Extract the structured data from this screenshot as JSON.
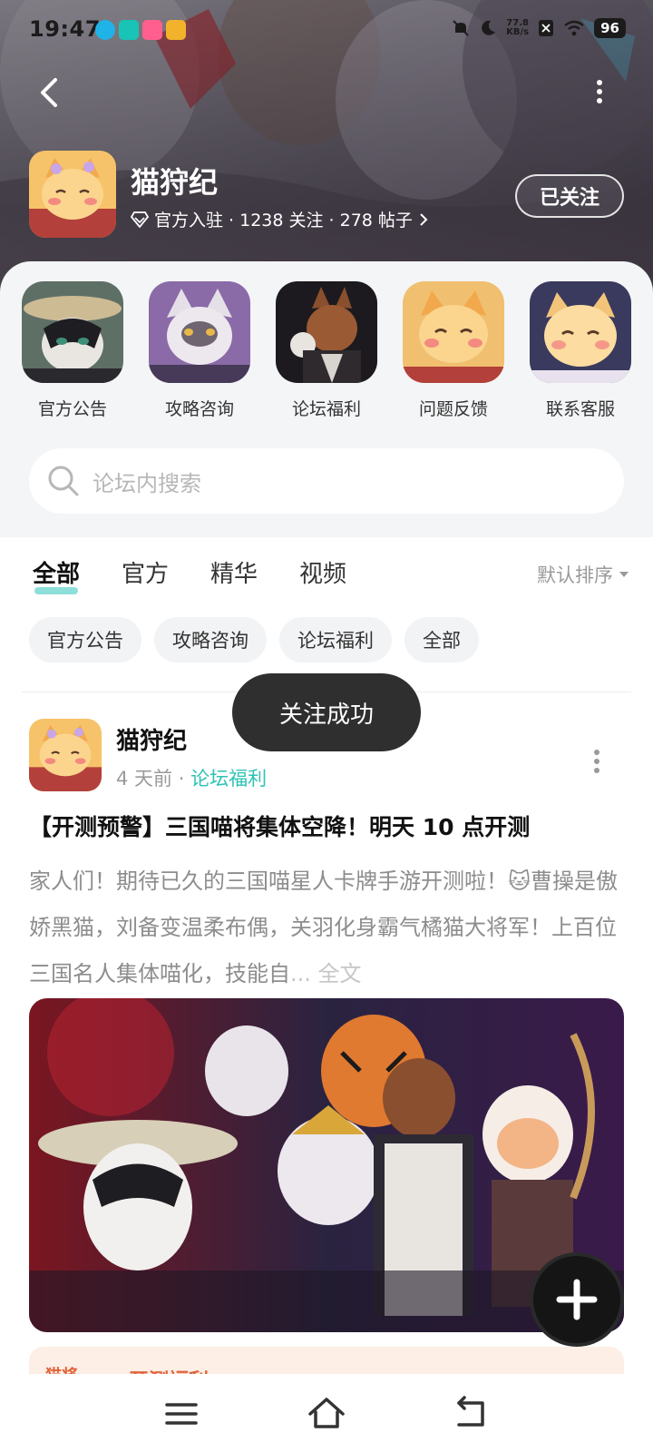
{
  "status_bar": {
    "time": "19:47",
    "net_speed_value": "77.8",
    "net_speed_unit": "KB/s",
    "battery": "96"
  },
  "forum": {
    "name": "猫狩纪",
    "meta": "官方入驻 · 1238 关注 · 278 帖子",
    "follow_label": "已关注"
  },
  "shortcuts": [
    {
      "label": "官方公告"
    },
    {
      "label": "攻略咨询"
    },
    {
      "label": "论坛福利"
    },
    {
      "label": "问题反馈"
    },
    {
      "label": "联系客服"
    }
  ],
  "search": {
    "placeholder": "论坛内搜索"
  },
  "tabs": [
    {
      "label": "全部",
      "active": true
    },
    {
      "label": "官方"
    },
    {
      "label": "精华"
    },
    {
      "label": "视频"
    }
  ],
  "sort_label": "默认排序",
  "chips": [
    "官方公告",
    "攻略咨询",
    "论坛福利",
    "全部"
  ],
  "toast": "关注成功",
  "post": {
    "author": "猫狩纪",
    "time": "4 天前",
    "category": "论坛福利",
    "title": "【开测预警】三国喵将集体空降！明天 10 点开测",
    "body": "家人们！期待已久的三国喵星人卡牌手游开测啦！🐱曹操是傲娇黑猫，刘备变温柔布偶，关羽化身霸气橘猫大将军！上百位三国名人集体喵化，技能自",
    "read_more": "... 全文"
  },
  "next_post": {
    "tag": "猫将",
    "title": "开测福利"
  },
  "colors": {
    "accent": "#2ec2b6",
    "toast_bg": "#2f2f2f",
    "panel_bg": "#f4f5f7"
  }
}
